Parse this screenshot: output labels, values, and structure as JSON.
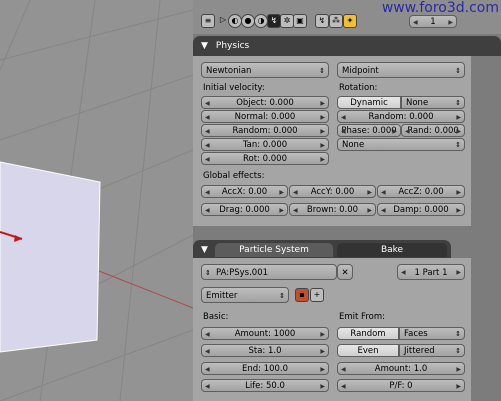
{
  "watermark": "www.foro3d.com",
  "header": {
    "frame_value": "1",
    "icons": [
      "window-type-icon",
      "play-icon",
      "shading-icon",
      "material-icon",
      "world-icon",
      "object-icon",
      "physics-icon",
      "scene-icon",
      "link-icon",
      "particle-icon"
    ]
  },
  "physics": {
    "title": "Physics",
    "solver": "Newtonian",
    "integration": "Midpoint",
    "initial_velocity_label": "Initial velocity:",
    "rotation_label": "Rotation:",
    "object": "Object: 0.000",
    "normal": "Normal: 0.000",
    "random": "Random: 0.000",
    "tan": "Tan: 0.000",
    "rot": "Rot: 0.000",
    "rot_dynamic": "Dynamic",
    "rot_none": "None",
    "rot_random": "Random: 0.000",
    "phase": "Phase: 0.000",
    "rand": "Rand: 0.000",
    "angular": "None",
    "global_effects_label": "Global effects:",
    "accx": "AccX: 0.00",
    "accy": "AccY: 0.00",
    "accz": "AccZ: 0.00",
    "drag": "Drag: 0.000",
    "brown": "Brown: 0.00",
    "damp": "Damp: 0.000"
  },
  "particles": {
    "tab_system": "Particle System",
    "tab_bake": "Bake",
    "psys_name": "PA:PSys.001",
    "part_counter": "1 Part 1",
    "type": "Emitter",
    "basic_label": "Basic:",
    "emit_from_label": "Emit From:",
    "amount": "Amount: 1000",
    "sta": "Sta: 1.0",
    "end": "End: 100.0",
    "life": "Life: 50.0",
    "random_btn": "Random",
    "faces_btn": "Faces",
    "even_btn": "Even",
    "jittered_btn": "Jittered",
    "jit_amount": "Amount: 1.0",
    "pf": "P/F: 0"
  },
  "colors": {
    "viewport_bg": "#939393",
    "plane": "#d8d6ea",
    "accent_red": "#c01818",
    "panel_title": "#3f3f3f"
  }
}
